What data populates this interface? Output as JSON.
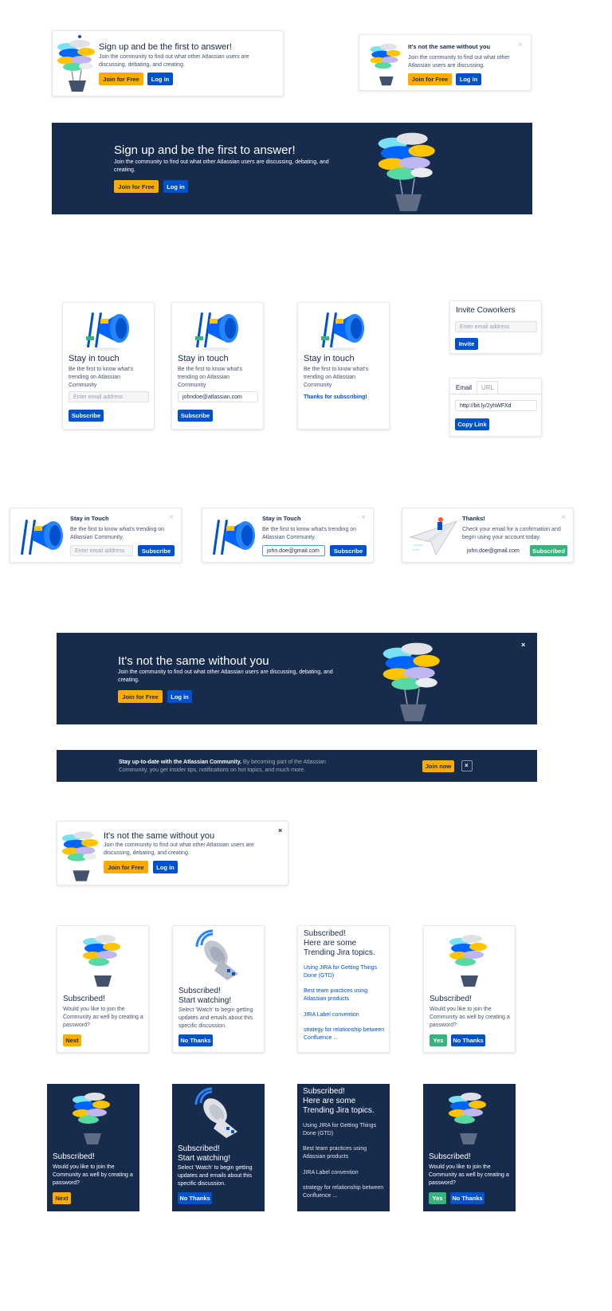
{
  "colors": {
    "navy": "#172b4d",
    "yellow": "#ffab00",
    "blue": "#0052cc",
    "green": "#36b37e"
  },
  "a1": {
    "title": "Sign up and be the first to answer!",
    "body": "Join the community to find out what other Atlassian users are discussing, debating, and creating.",
    "join": "Join for Free",
    "login": "Log in"
  },
  "a2": {
    "title": "It's not the same without you",
    "body": "Join the community to find out what other Atlassian users are discussing.",
    "join": "Join for Free",
    "login": "Log in",
    "close": "×"
  },
  "b1": {
    "title": "Sign up and be the first to answer!",
    "body": "Join the community to find out what other Atlassian users are discussing, debating, and creating.",
    "join": "Join for Free",
    "login": "Log in"
  },
  "c1": {
    "title": "Stay in touch",
    "body": "Be the first to know what's trending on Atlassian Community",
    "placeholder": "Enter email address",
    "subscribe": "Subscribe"
  },
  "c2": {
    "title": "Stay in touch",
    "body": "Be the first to know what's trending on Atlassian Community",
    "value": "johndoe@atlassian.com",
    "subscribe": "Subscribe"
  },
  "c3": {
    "title": "Stay in touch",
    "body": "Be the first to know what's trending on Atlassian Community",
    "thanks": "Thanks for subscribing!"
  },
  "invite": {
    "title": "Invite Coworkers",
    "placeholder": "Enter email address",
    "button": "Invite"
  },
  "share": {
    "tab_email": "Email",
    "tab_url": "URL",
    "url": "http://bit.ly/2yhWFXd",
    "button": "Copy Link"
  },
  "d1": {
    "title": "Stay in Touch",
    "body": "Be the first to know what's trending on Atlassian Community.",
    "placeholder": "Enter email address",
    "subscribe": "Subscribe",
    "close": "×"
  },
  "d2": {
    "title": "Stay in Touch",
    "body": "Be the first to know what's trending on Atlassian Community.",
    "value": "john.doe@gmail.com",
    "subscribe": "Subscribe",
    "close": "×"
  },
  "d3": {
    "title": "Thanks!",
    "body": "Check your email for a confirmation and begin using your account today.",
    "value": "john.doe@gmail.com",
    "subscribed": "Subscribed",
    "close": "×"
  },
  "e1": {
    "title": "It's not the same without you",
    "body": "Join the community to find out what other Atlassian users are discussing, debating, and creating.",
    "join": "Join for Free",
    "login": "Log in",
    "close": "×"
  },
  "f1": {
    "bold": "Stay up-to-date with the Atlassian Community.",
    "rest": " By becoming part of the Atlassian Community, you get insider tips, notifications on hot topics, and much more.",
    "join": "Join now",
    "close": "×"
  },
  "g1": {
    "title": "It's not the same without you",
    "body": "Join the community to find out what other Atlassian users are discussing, debating, and creating.",
    "join": "Join for Free",
    "login": "Log in",
    "close": "×"
  },
  "h": {
    "sub_title": "Subscribed!",
    "sub_body": "Would you like to join the Community as well by creating a password?",
    "next": "Next",
    "watch_title": "Subscribed!\nStart watching!",
    "watch_body": "Select 'Watch' to begin getting updates and emails about this specific discussion.",
    "no_thanks": "No Thanks",
    "yes": "Yes",
    "trend_title": "Subscribed!\nHere are some\nTrending Jira topics.",
    "topics": [
      "Using JIRA for Getting Things Done (GTD)",
      "Best team practices using Atlassian products",
      "JIRA Label convention",
      "strategy for relationship between Confluence ..."
    ]
  }
}
